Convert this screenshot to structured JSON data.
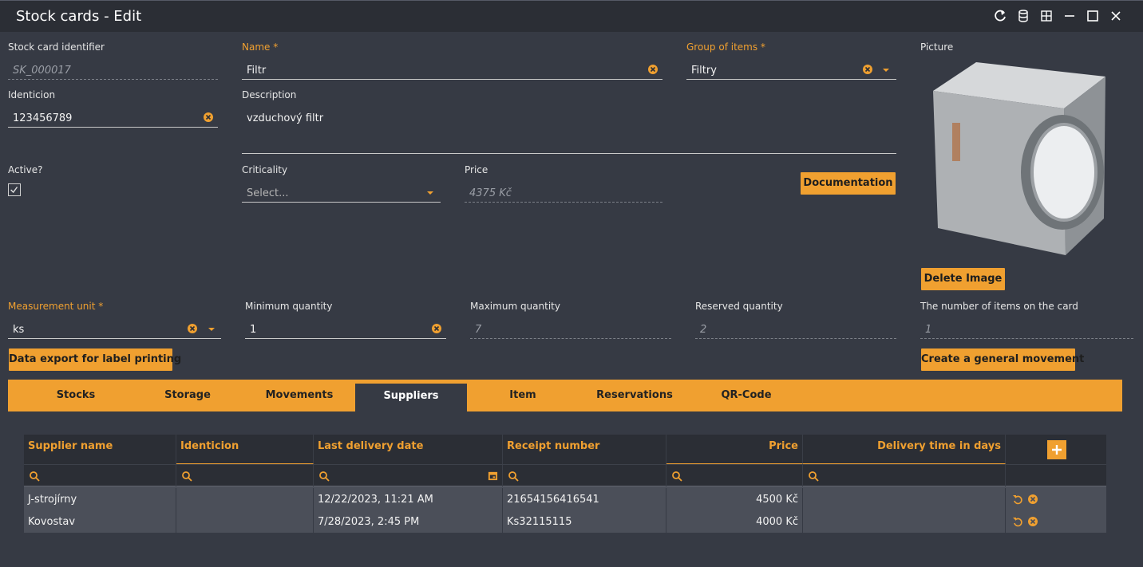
{
  "window": {
    "title": "Stock cards - Edit"
  },
  "form": {
    "identifier": {
      "label": "Stock card identifier",
      "value": "SK_000017"
    },
    "name": {
      "label": "Name *",
      "value": "Filtr"
    },
    "group": {
      "label": "Group of items *",
      "value": "Filtry"
    },
    "picture": {
      "label": "Picture"
    },
    "identicion": {
      "label": "Identicion",
      "value": "123456789"
    },
    "description": {
      "label": "Description",
      "value": "vzduchový filtr"
    },
    "active": {
      "label": "Active?",
      "checked": true
    },
    "criticality": {
      "label": "Criticality",
      "placeholder": "Select..."
    },
    "price": {
      "label": "Price",
      "value": "4375 Kč"
    },
    "documentation_button": "Documentation",
    "delete_image_button": "Delete Image",
    "measurement_unit": {
      "label": "Measurement unit *",
      "value": "ks"
    },
    "minimum_quantity": {
      "label": "Minimum quantity",
      "value": "1"
    },
    "maximum_quantity": {
      "label": "Maximum quantity",
      "value": "7"
    },
    "reserved_quantity": {
      "label": "Reserved quantity",
      "value": "2"
    },
    "items_on_card": {
      "label": "The number of items on the card",
      "value": "1"
    },
    "export_button": "Data export for label printing",
    "movement_button": "Create a general movement"
  },
  "tabs": [
    {
      "label": "Stocks"
    },
    {
      "label": "Storage"
    },
    {
      "label": "Movements"
    },
    {
      "label": "Suppliers",
      "active": true
    },
    {
      "label": "Item"
    },
    {
      "label": "Reservations"
    },
    {
      "label": "QR-Code"
    }
  ],
  "suppliers_grid": {
    "columns": [
      "Supplier name",
      "Identicion",
      "Last delivery date",
      "Receipt number",
      "Price",
      "Delivery time in days"
    ],
    "rows": [
      [
        "J-strojírny",
        "",
        "12/22/2023, 11:21 AM",
        "21654156416541",
        "4500 Kč",
        ""
      ],
      [
        "Kovostav",
        "",
        "7/28/2023, 2:45 PM",
        "Ks32115115",
        "4000 Kč",
        ""
      ]
    ]
  },
  "colors": {
    "accent": "#f0a030",
    "background": "#363a44",
    "titlebar": "#2b2e35"
  },
  "icons": [
    "refresh-icon",
    "database-icon",
    "grid-icon",
    "minimize-icon",
    "maximize-icon",
    "close-icon",
    "clear-icon",
    "dropdown-caret-icon",
    "search-icon",
    "calendar-icon",
    "add-icon",
    "undo-icon",
    "delete-icon",
    "checkmark-icon"
  ]
}
